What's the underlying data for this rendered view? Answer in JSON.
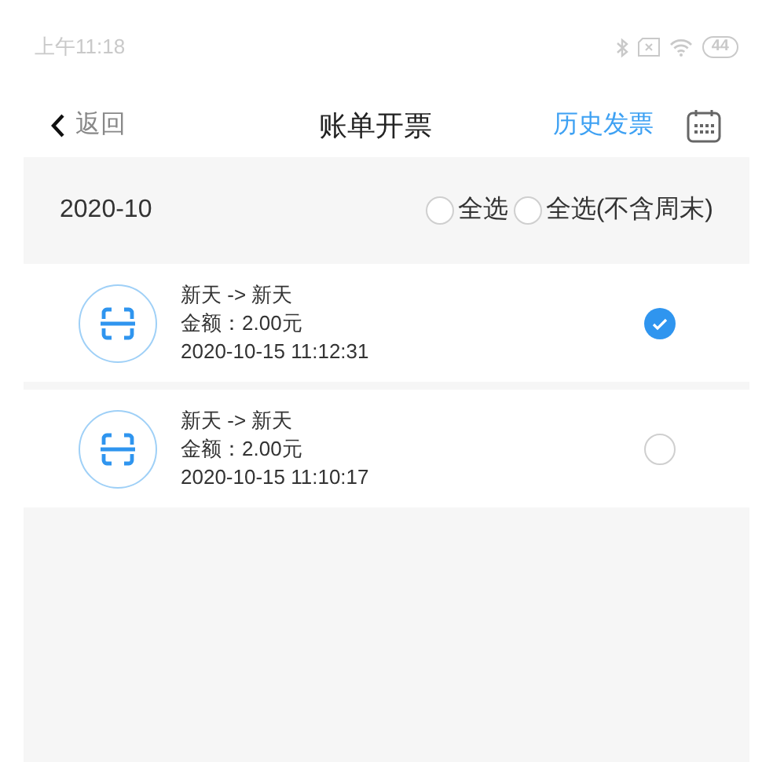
{
  "status_bar": {
    "time": "上午11:18",
    "battery": "44"
  },
  "header": {
    "back": "返回",
    "title": "账单开票",
    "history": "历史发票"
  },
  "group": {
    "month": "2020-10",
    "options": [
      {
        "label": "全选",
        "selected": false
      },
      {
        "label": "全选(不含周末)",
        "selected": false
      }
    ]
  },
  "bills": [
    {
      "route": "新天 -> 新天",
      "amount": "金额：2.00元",
      "time": "2020-10-15 11:12:31",
      "selected": true
    },
    {
      "route": "新天 -> 新天",
      "amount": "金额：2.00元",
      "time": "2020-10-15 11:10:17",
      "selected": false
    }
  ]
}
